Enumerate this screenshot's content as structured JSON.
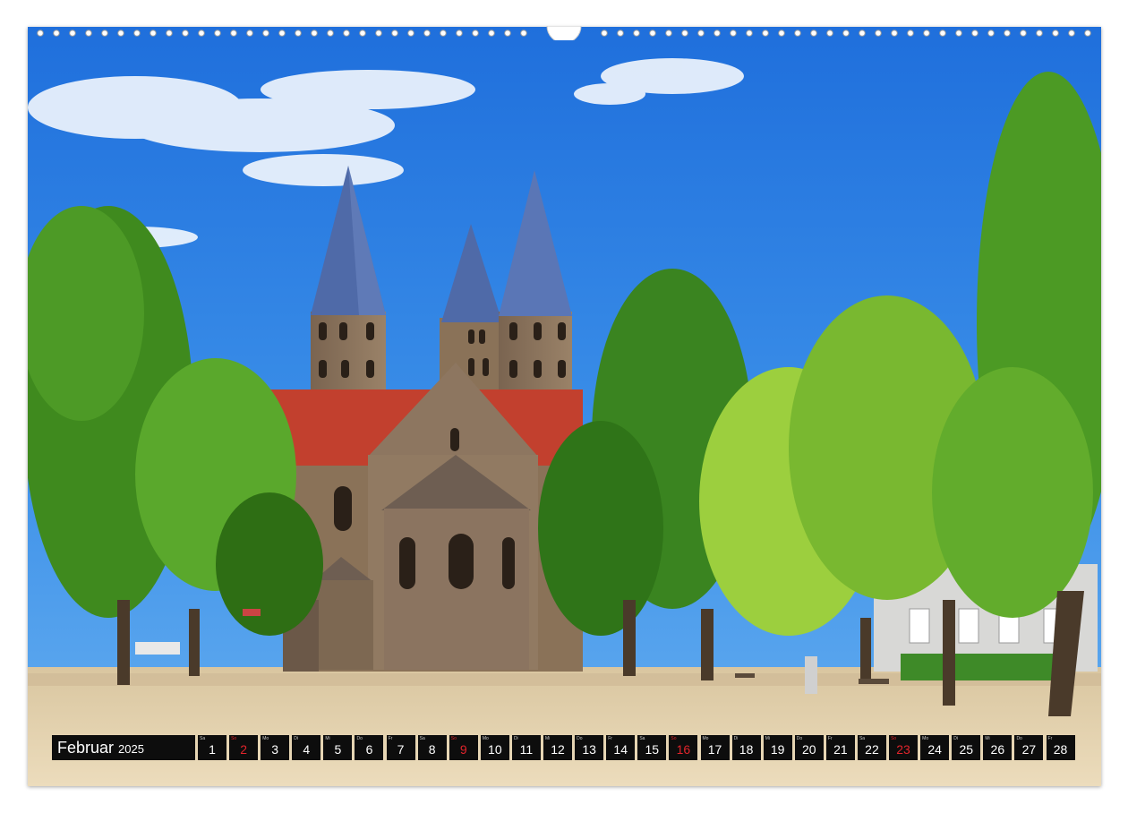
{
  "calendar": {
    "month": "Februar",
    "year": "2025",
    "days": [
      {
        "wd": "Sa",
        "num": "1",
        "sunday": false
      },
      {
        "wd": "So",
        "num": "2",
        "sunday": true
      },
      {
        "wd": "Mo",
        "num": "3",
        "sunday": false
      },
      {
        "wd": "Di",
        "num": "4",
        "sunday": false
      },
      {
        "wd": "Mi",
        "num": "5",
        "sunday": false
      },
      {
        "wd": "Do",
        "num": "6",
        "sunday": false
      },
      {
        "wd": "Fr",
        "num": "7",
        "sunday": false
      },
      {
        "wd": "Sa",
        "num": "8",
        "sunday": false
      },
      {
        "wd": "So",
        "num": "9",
        "sunday": true
      },
      {
        "wd": "Mo",
        "num": "10",
        "sunday": false
      },
      {
        "wd": "Di",
        "num": "11",
        "sunday": false
      },
      {
        "wd": "Mi",
        "num": "12",
        "sunday": false
      },
      {
        "wd": "Do",
        "num": "13",
        "sunday": false
      },
      {
        "wd": "Fr",
        "num": "14",
        "sunday": false
      },
      {
        "wd": "Sa",
        "num": "15",
        "sunday": false
      },
      {
        "wd": "So",
        "num": "16",
        "sunday": true
      },
      {
        "wd": "Mo",
        "num": "17",
        "sunday": false
      },
      {
        "wd": "Di",
        "num": "18",
        "sunday": false
      },
      {
        "wd": "Mi",
        "num": "19",
        "sunday": false
      },
      {
        "wd": "Do",
        "num": "20",
        "sunday": false
      },
      {
        "wd": "Fr",
        "num": "21",
        "sunday": false
      },
      {
        "wd": "Sa",
        "num": "22",
        "sunday": false
      },
      {
        "wd": "So",
        "num": "23",
        "sunday": true
      },
      {
        "wd": "Mo",
        "num": "24",
        "sunday": false
      },
      {
        "wd": "Di",
        "num": "25",
        "sunday": false
      },
      {
        "wd": "Mi",
        "num": "26",
        "sunday": false
      },
      {
        "wd": "Do",
        "num": "27",
        "sunday": false
      },
      {
        "wd": "Fr",
        "num": "28",
        "sunday": false
      }
    ]
  },
  "colors": {
    "sky": "#2f86e4",
    "foliage": "#4e9a22",
    "roof": "#c2402e",
    "stone": "#8a7258",
    "spire": "#4f6aa8",
    "ground": "#e6d4b0",
    "sunday_text": "#e0242b"
  }
}
